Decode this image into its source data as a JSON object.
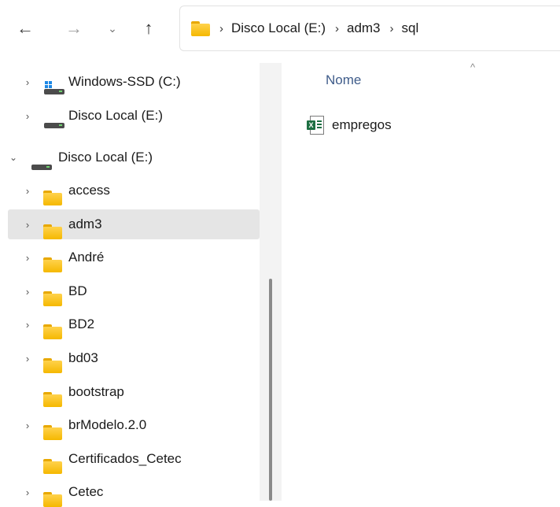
{
  "toolbar": {
    "back_icon": "←",
    "forward_icon": "→",
    "recent_icon": "⌄",
    "up_icon": "↑"
  },
  "address": {
    "crumbs": [
      "Disco Local (E:)",
      "adm3",
      "sql"
    ]
  },
  "sidebar": {
    "items": [
      {
        "label": "Windows-SSD (C:)",
        "icon": "windows-drive-icon",
        "expander": "collapsed"
      },
      {
        "label": "Disco Local (E:)",
        "icon": "drive-icon",
        "expander": "collapsed"
      },
      {
        "label": "Disco Local (E:)",
        "icon": "drive-icon",
        "expander": "expanded"
      },
      {
        "label": "access",
        "icon": "folder-icon",
        "expander": "collapsed"
      },
      {
        "label": "adm3",
        "icon": "folder-icon",
        "expander": "collapsed",
        "selected": true
      },
      {
        "label": "André",
        "icon": "folder-icon",
        "expander": "collapsed"
      },
      {
        "label": "BD",
        "icon": "folder-icon",
        "expander": "collapsed"
      },
      {
        "label": "BD2",
        "icon": "folder-icon",
        "expander": "collapsed"
      },
      {
        "label": "bd03",
        "icon": "folder-icon",
        "expander": "collapsed"
      },
      {
        "label": "bootstrap",
        "icon": "folder-icon",
        "expander": "none"
      },
      {
        "label": "brModelo.2.0",
        "icon": "folder-icon",
        "expander": "collapsed"
      },
      {
        "label": "Certificados_Cetec",
        "icon": "folder-icon",
        "expander": "none"
      },
      {
        "label": "Cetec",
        "icon": "folder-icon",
        "expander": "collapsed"
      }
    ]
  },
  "content": {
    "column_header": "Nome",
    "files": [
      {
        "name": "empregos",
        "icon": "excel-file-icon"
      }
    ]
  },
  "colors": {
    "selection": "#e5e5e5",
    "header_text": "#3f5c8a",
    "folder": "#f5b800",
    "excel": "#1d6f42"
  }
}
